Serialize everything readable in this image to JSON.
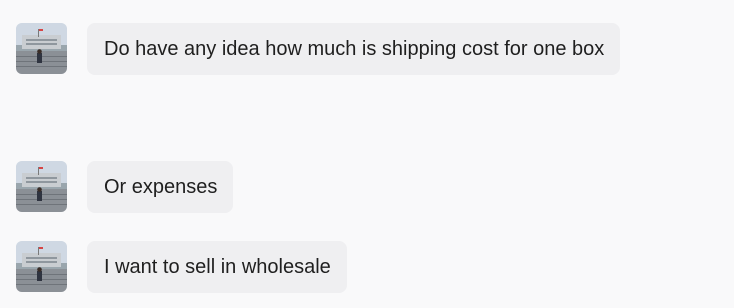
{
  "conversation": {
    "messages": [
      {
        "text": "Do have any idea how much is shipping cost for one box",
        "avatar_icon": "user-avatar-photo"
      },
      {
        "text": "Or expenses",
        "avatar_icon": "user-avatar-photo"
      },
      {
        "text": "I want to sell in wholesale",
        "avatar_icon": "user-avatar-photo"
      }
    ]
  },
  "colors": {
    "background": "#f9f9fa",
    "bubble": "#efeff1",
    "text": "#1f1f1f"
  }
}
